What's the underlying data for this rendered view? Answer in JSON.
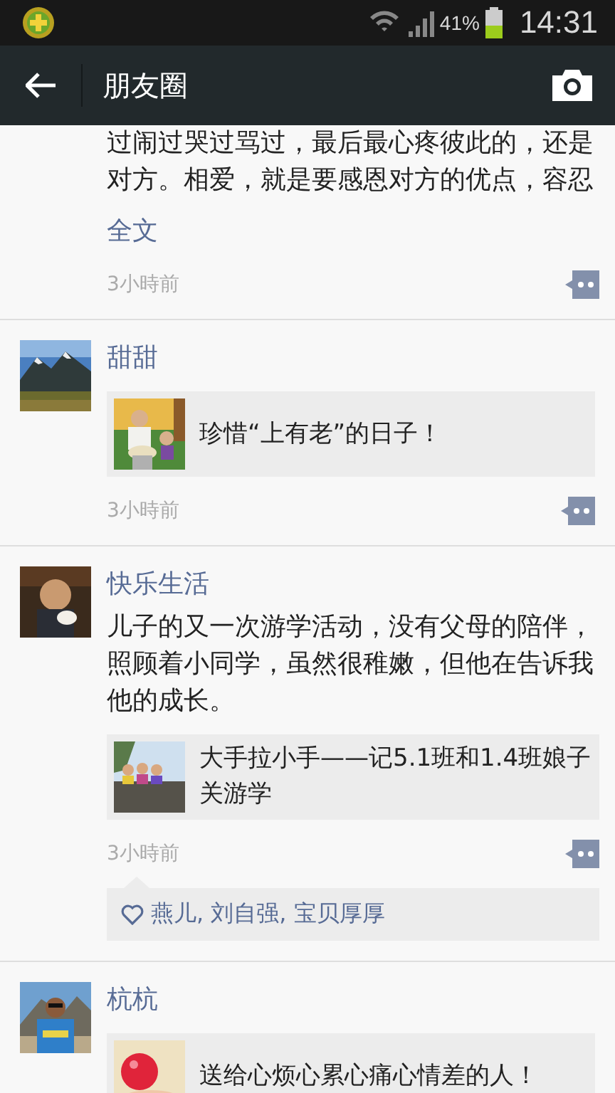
{
  "status_bar": {
    "battery_text": "41%",
    "time": "14:31"
  },
  "header": {
    "title": "朋友圈"
  },
  "posts": [
    {
      "text": "过闹过哭过骂过，最后最心疼彼此的，还是对方。相爱，就是要感恩对方的优点，容忍",
      "more_link": "全文",
      "time": "3小時前"
    },
    {
      "name": "甜甜",
      "card": {
        "title": "珍惜“上有老”的日子！"
      },
      "time": "3小時前"
    },
    {
      "name": "快乐生活",
      "text": "儿子的又一次游学活动，没有父母的陪伴，照顾着小同学，虽然很稚嫩，但他在告诉我他的成长。",
      "card": {
        "title": "大手拉小手——记5.1班和1.4班娘子关游学"
      },
      "time": "3小時前",
      "likes": "燕儿, 刘自强, 宝贝厚厚"
    },
    {
      "name": "杭杭",
      "card": {
        "title": "送给心烦心累心痛心情差的人！"
      }
    }
  ]
}
